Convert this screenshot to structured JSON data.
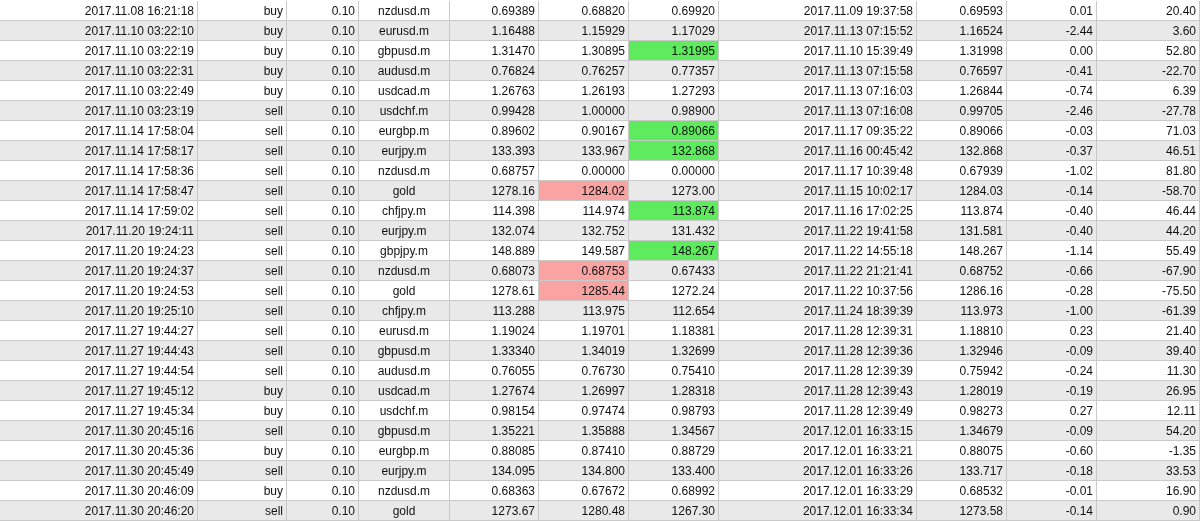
{
  "rows": [
    {
      "cells": [
        "2017.11.08 16:21:18",
        "buy",
        "0.10",
        "nzdusd.m",
        "0.69389",
        "0.68820",
        "0.69920",
        "2017.11.09 19:37:58",
        "0.69593",
        "0.01",
        "20.40"
      ],
      "stop_hit": false,
      "target_hit": false
    },
    {
      "cells": [
        "2017.11.10 03:22:10",
        "buy",
        "0.10",
        "eurusd.m",
        "1.16488",
        "1.15929",
        "1.17029",
        "2017.11.13 07:15:52",
        "1.16524",
        "-2.44",
        "3.60"
      ],
      "stop_hit": false,
      "target_hit": false
    },
    {
      "cells": [
        "2017.11.10 03:22:19",
        "buy",
        "0.10",
        "gbpusd.m",
        "1.31470",
        "1.30895",
        "1.31995",
        "2017.11.10 15:39:49",
        "1.31998",
        "0.00",
        "52.80"
      ],
      "stop_hit": false,
      "target_hit": true
    },
    {
      "cells": [
        "2017.11.10 03:22:31",
        "buy",
        "0.10",
        "audusd.m",
        "0.76824",
        "0.76257",
        "0.77357",
        "2017.11.13 07:15:58",
        "0.76597",
        "-0.41",
        "-22.70"
      ],
      "stop_hit": false,
      "target_hit": false
    },
    {
      "cells": [
        "2017.11.10 03:22:49",
        "buy",
        "0.10",
        "usdcad.m",
        "1.26763",
        "1.26193",
        "1.27293",
        "2017.11.13 07:16:03",
        "1.26844",
        "-0.74",
        "6.39"
      ],
      "stop_hit": false,
      "target_hit": false
    },
    {
      "cells": [
        "2017.11.10 03:23:19",
        "sell",
        "0.10",
        "usdchf.m",
        "0.99428",
        "1.00000",
        "0.98900",
        "2017.11.13 07:16:08",
        "0.99705",
        "-2.46",
        "-27.78"
      ],
      "stop_hit": false,
      "target_hit": false
    },
    {
      "cells": [
        "2017.11.14 17:58:04",
        "sell",
        "0.10",
        "eurgbp.m",
        "0.89602",
        "0.90167",
        "0.89066",
        "2017.11.17 09:35:22",
        "0.89066",
        "-0.03",
        "71.03"
      ],
      "stop_hit": false,
      "target_hit": true
    },
    {
      "cells": [
        "2017.11.14 17:58:17",
        "sell",
        "0.10",
        "eurjpy.m",
        "133.393",
        "133.967",
        "132.868",
        "2017.11.16 00:45:42",
        "132.868",
        "-0.37",
        "46.51"
      ],
      "stop_hit": false,
      "target_hit": true
    },
    {
      "cells": [
        "2017.11.14 17:58:36",
        "sell",
        "0.10",
        "nzdusd.m",
        "0.68757",
        "0.00000",
        "0.00000",
        "2017.11.17 10:39:48",
        "0.67939",
        "-1.02",
        "81.80"
      ],
      "stop_hit": false,
      "target_hit": false
    },
    {
      "cells": [
        "2017.11.14 17:58:47",
        "sell",
        "0.10",
        "gold",
        "1278.16",
        "1284.02",
        "1273.00",
        "2017.11.15 10:02:17",
        "1284.03",
        "-0.14",
        "-58.70"
      ],
      "stop_hit": true,
      "target_hit": false
    },
    {
      "cells": [
        "2017.11.14 17:59:02",
        "sell",
        "0.10",
        "chfjpy.m",
        "114.398",
        "114.974",
        "113.874",
        "2017.11.16 17:02:25",
        "113.874",
        "-0.40",
        "46.44"
      ],
      "stop_hit": false,
      "target_hit": true
    },
    {
      "cells": [
        "2017.11.20 19:24:11",
        "sell",
        "0.10",
        "eurjpy.m",
        "132.074",
        "132.752",
        "131.432",
        "2017.11.22 19:41:58",
        "131.581",
        "-0.40",
        "44.20"
      ],
      "stop_hit": false,
      "target_hit": false
    },
    {
      "cells": [
        "2017.11.20 19:24:23",
        "sell",
        "0.10",
        "gbpjpy.m",
        "148.889",
        "149.587",
        "148.267",
        "2017.11.22 14:55:18",
        "148.267",
        "-1.14",
        "55.49"
      ],
      "stop_hit": false,
      "target_hit": true
    },
    {
      "cells": [
        "2017.11.20 19:24:37",
        "sell",
        "0.10",
        "nzdusd.m",
        "0.68073",
        "0.68753",
        "0.67433",
        "2017.11.22 21:21:41",
        "0.68752",
        "-0.66",
        "-67.90"
      ],
      "stop_hit": true,
      "target_hit": false
    },
    {
      "cells": [
        "2017.11.20 19:24:53",
        "sell",
        "0.10",
        "gold",
        "1278.61",
        "1285.44",
        "1272.24",
        "2017.11.22 10:37:56",
        "1286.16",
        "-0.28",
        "-75.50"
      ],
      "stop_hit": true,
      "target_hit": false
    },
    {
      "cells": [
        "2017.11.20 19:25:10",
        "sell",
        "0.10",
        "chfjpy.m",
        "113.288",
        "113.975",
        "112.654",
        "2017.11.24 18:39:39",
        "113.973",
        "-1.00",
        "-61.39"
      ],
      "stop_hit": false,
      "target_hit": false
    },
    {
      "cells": [
        "2017.11.27 19:44:27",
        "sell",
        "0.10",
        "eurusd.m",
        "1.19024",
        "1.19701",
        "1.18381",
        "2017.11.28 12:39:31",
        "1.18810",
        "0.23",
        "21.40"
      ],
      "stop_hit": false,
      "target_hit": false
    },
    {
      "cells": [
        "2017.11.27 19:44:43",
        "sell",
        "0.10",
        "gbpusd.m",
        "1.33340",
        "1.34019",
        "1.32699",
        "2017.11.28 12:39:36",
        "1.32946",
        "-0.09",
        "39.40"
      ],
      "stop_hit": false,
      "target_hit": false
    },
    {
      "cells": [
        "2017.11.27 19:44:54",
        "sell",
        "0.10",
        "audusd.m",
        "0.76055",
        "0.76730",
        "0.75410",
        "2017.11.28 12:39:39",
        "0.75942",
        "-0.24",
        "11.30"
      ],
      "stop_hit": false,
      "target_hit": false
    },
    {
      "cells": [
        "2017.11.27 19:45:12",
        "buy",
        "0.10",
        "usdcad.m",
        "1.27674",
        "1.26997",
        "1.28318",
        "2017.11.28 12:39:43",
        "1.28019",
        "-0.19",
        "26.95"
      ],
      "stop_hit": false,
      "target_hit": false
    },
    {
      "cells": [
        "2017.11.27 19:45:34",
        "buy",
        "0.10",
        "usdchf.m",
        "0.98154",
        "0.97474",
        "0.98793",
        "2017.11.28 12:39:49",
        "0.98273",
        "0.27",
        "12.11"
      ],
      "stop_hit": false,
      "target_hit": false
    },
    {
      "cells": [
        "2017.11.30 20:45:16",
        "sell",
        "0.10",
        "gbpusd.m",
        "1.35221",
        "1.35888",
        "1.34567",
        "2017.12.01 16:33:15",
        "1.34679",
        "-0.09",
        "54.20"
      ],
      "stop_hit": false,
      "target_hit": false
    },
    {
      "cells": [
        "2017.11.30 20:45:36",
        "buy",
        "0.10",
        "eurgbp.m",
        "0.88085",
        "0.87410",
        "0.88729",
        "2017.12.01 16:33:21",
        "0.88075",
        "-0.60",
        "-1.35"
      ],
      "stop_hit": false,
      "target_hit": false
    },
    {
      "cells": [
        "2017.11.30 20:45:49",
        "sell",
        "0.10",
        "eurjpy.m",
        "134.095",
        "134.800",
        "133.400",
        "2017.12.01 16:33:26",
        "133.717",
        "-0.18",
        "33.53"
      ],
      "stop_hit": false,
      "target_hit": false
    },
    {
      "cells": [
        "2017.11.30 20:46:09",
        "buy",
        "0.10",
        "nzdusd.m",
        "0.68363",
        "0.67672",
        "0.68992",
        "2017.12.01 16:33:29",
        "0.68532",
        "-0.01",
        "16.90"
      ],
      "stop_hit": false,
      "target_hit": false
    },
    {
      "cells": [
        "2017.11.30 20:46:20",
        "sell",
        "0.10",
        "gold",
        "1273.67",
        "1280.48",
        "1267.30",
        "2017.12.01 16:33:34",
        "1273.58",
        "-0.14",
        "0.90"
      ],
      "stop_hit": false,
      "target_hit": false
    }
  ]
}
